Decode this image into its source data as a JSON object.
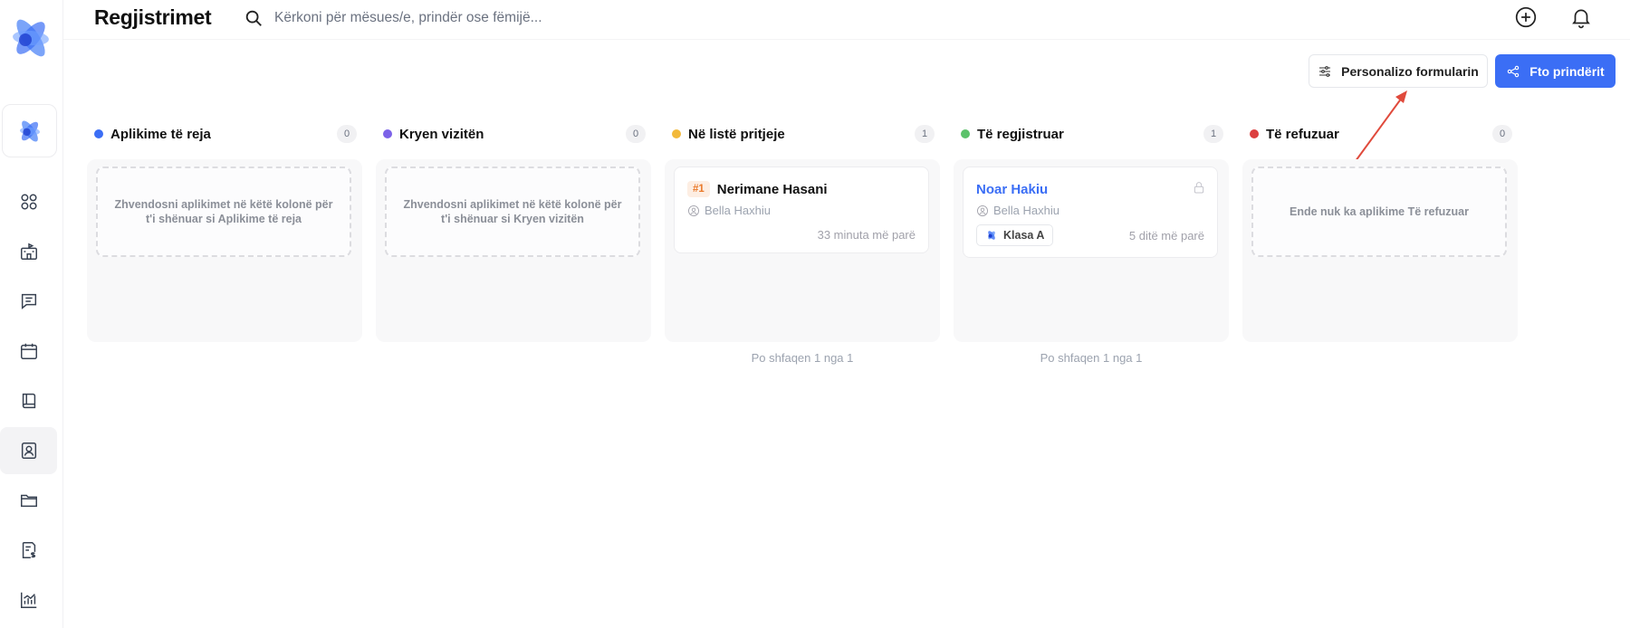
{
  "header": {
    "title": "Regjistrimet",
    "search_placeholder": "Kërkoni për mësues/e, prindër ose fëmijë..."
  },
  "actions": {
    "customize_label": "Personalizo formularin",
    "invite_label": "Fto prindërit"
  },
  "sidebar": {
    "items": [
      {
        "icon": "grid-icon"
      },
      {
        "icon": "school-icon"
      },
      {
        "icon": "message-icon"
      },
      {
        "icon": "calendar-icon"
      },
      {
        "icon": "book-icon"
      },
      {
        "icon": "enrollment-icon",
        "active": true
      },
      {
        "icon": "folder-icon"
      },
      {
        "icon": "billing-icon"
      },
      {
        "icon": "analytics-icon"
      }
    ]
  },
  "columns": [
    {
      "title": "Aplikime të reja",
      "count": "0",
      "color": "#3b6ef5",
      "empty_text": "Zhvendosni aplikimet në këtë kolonë për t'i shënuar si Aplikime të reja"
    },
    {
      "title": "Kryen vizitën",
      "count": "0",
      "color": "#7c62e8",
      "empty_text": "Zhvendosni aplikimet në këtë kolonë për t'i shënuar si Kryen vizitën"
    },
    {
      "title": "Në listë pritjeje",
      "count": "1",
      "color": "#f2b93b",
      "footer": "Po shfaqen 1 nga 1",
      "card": {
        "number": "#1",
        "name": "Nerimane Hasani",
        "parent": "Bella Haxhiu",
        "time": "33 minuta më parë"
      }
    },
    {
      "title": "Të regjistruar",
      "count": "1",
      "color": "#5cc26b",
      "footer": "Po shfaqen 1 nga 1",
      "card": {
        "name": "Noar Hakiu",
        "parent": "Bella Haxhiu",
        "class": "Klasa A",
        "time": "5 ditë më parë"
      }
    },
    {
      "title": "Të refuzuar",
      "count": "0",
      "color": "#dc3f3f",
      "empty_text": "Ende nuk ka aplikime Të refuzuar"
    }
  ],
  "colors": {
    "accent": "#3b6ef5",
    "annotation_arrow": "#e04a3c"
  }
}
